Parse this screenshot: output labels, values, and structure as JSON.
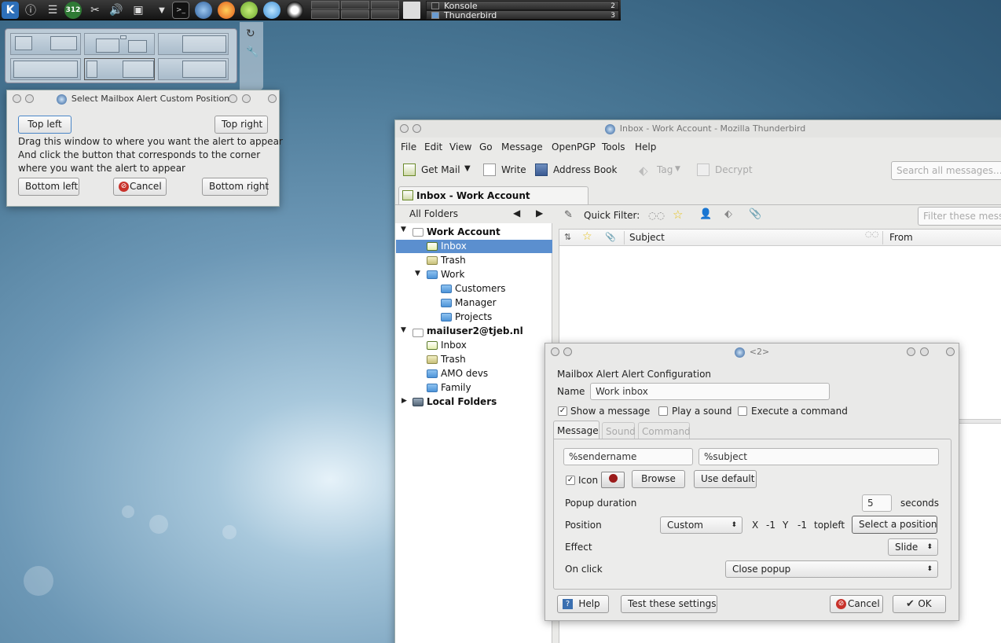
{
  "panel": {
    "badge": "312",
    "tasks": [
      {
        "label": "Konsole",
        "count": "2"
      },
      {
        "label": "Thunderbird",
        "count": "3"
      }
    ]
  },
  "select_dialog": {
    "title": "Select Mailbox Alert Custom Position",
    "top_left": "Top left",
    "top_right": "Top right",
    "line1": "Drag this window to where you want the alert to appear",
    "line2": "And click the button that corresponds to the corner",
    "line3": "where you want the alert to appear",
    "bottom_left": "Bottom left",
    "cancel": "Cancel",
    "bottom_right": "Bottom right"
  },
  "tb": {
    "title": "Inbox - Work Account - Mozilla Thunderbird",
    "menu": [
      "File",
      "Edit",
      "View",
      "Go",
      "Message",
      "OpenPGP",
      "Tools",
      "Help"
    ],
    "toolbar": {
      "get_mail": "Get Mail",
      "write": "Write",
      "address_book": "Address Book",
      "tag": "Tag",
      "decrypt": "Decrypt",
      "search_placeholder": "Search all messages..."
    },
    "tab": "Inbox - Work Account",
    "all_folders": "All Folders",
    "quick_filter": "Quick Filter:",
    "filter_placeholder": "Filter these messages",
    "columns": {
      "subject": "Subject",
      "from": "From"
    },
    "folders": {
      "acc1": "Work Account",
      "inbox": "Inbox",
      "trash": "Trash",
      "work": "Work",
      "customers": "Customers",
      "manager": "Manager",
      "projects": "Projects",
      "acc2": "mailuser2@tjeb.nl",
      "inbox2": "Inbox",
      "trash2": "Trash",
      "amo": "AMO devs",
      "family": "Family",
      "local": "Local Folders"
    }
  },
  "config": {
    "title": "<2>",
    "heading": "Mailbox Alert Alert Configuration",
    "name_label": "Name",
    "name_value": "Work inbox",
    "show_message": "Show a message",
    "play_sound": "Play a sound",
    "execute_command": "Execute a command",
    "tabs": [
      "Message",
      "Sound",
      "Command"
    ],
    "sendername": "%sendername",
    "subject": "%subject",
    "icon_label": "Icon",
    "browse": "Browse",
    "use_default": "Use default",
    "popup_duration": "Popup duration",
    "duration_value": "5",
    "seconds": "seconds",
    "position": "Position",
    "position_value": "Custom",
    "x_label": "X",
    "x_value": "-1",
    "y_label": "Y",
    "y_value": "-1",
    "corner": "topleft",
    "select_position": "Select a position",
    "effect": "Effect",
    "effect_value": "Slide",
    "on_click": "On click",
    "on_click_value": "Close popup",
    "help": "Help",
    "test": "Test these settings",
    "cancel": "Cancel",
    "ok": "OK"
  }
}
